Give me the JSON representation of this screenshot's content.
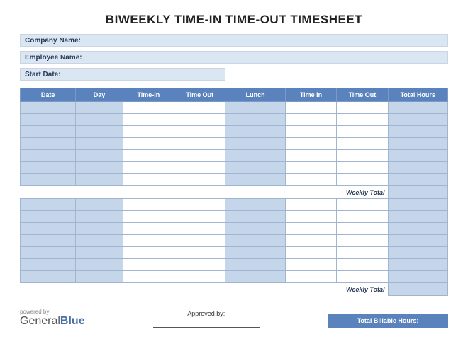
{
  "title": "BIWEEKLY TIME-IN TIME-OUT TIMESHEET",
  "info": {
    "company_label": "Company Name:",
    "employee_label": "Employee Name:",
    "start_label": "Start Date:"
  },
  "headers": {
    "date": "Date",
    "day": "Day",
    "timein": "Time-In",
    "timeout": "Time Out",
    "lunch": "Lunch",
    "timein2": "Time In",
    "timeout2": "Time Out",
    "total": "Total Hours"
  },
  "weekly_total_label": "Weekly Total",
  "approved_label": "Approved by:",
  "billable_label": "Total Billable Hours:",
  "powered_label": "powered by",
  "logo": {
    "part1": "General",
    "part2": "Blue"
  },
  "week1_rows": 7,
  "week2_rows": 7
}
